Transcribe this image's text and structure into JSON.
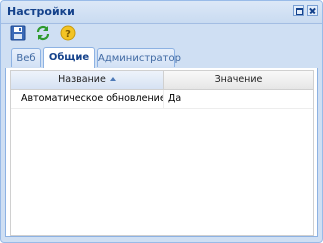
{
  "window": {
    "title": "Настройки"
  },
  "toolbar": {
    "buttons": [
      {
        "icon": "save-icon"
      },
      {
        "icon": "refresh-icon"
      },
      {
        "icon": "help-icon"
      }
    ]
  },
  "tabs": [
    {
      "label": "Веб",
      "active": false
    },
    {
      "label": "Общие",
      "active": true
    },
    {
      "label": "Администратор",
      "active": false
    }
  ],
  "grid": {
    "columns": [
      {
        "label": "Название",
        "sorted": "asc"
      },
      {
        "label": "Значение"
      }
    ],
    "rows": [
      {
        "name": "Автоматическое обновление с...",
        "value": "Да"
      }
    ]
  },
  "colors": {
    "accent": "#15428b",
    "border": "#99bbe8",
    "frame": "#cfdff3"
  }
}
